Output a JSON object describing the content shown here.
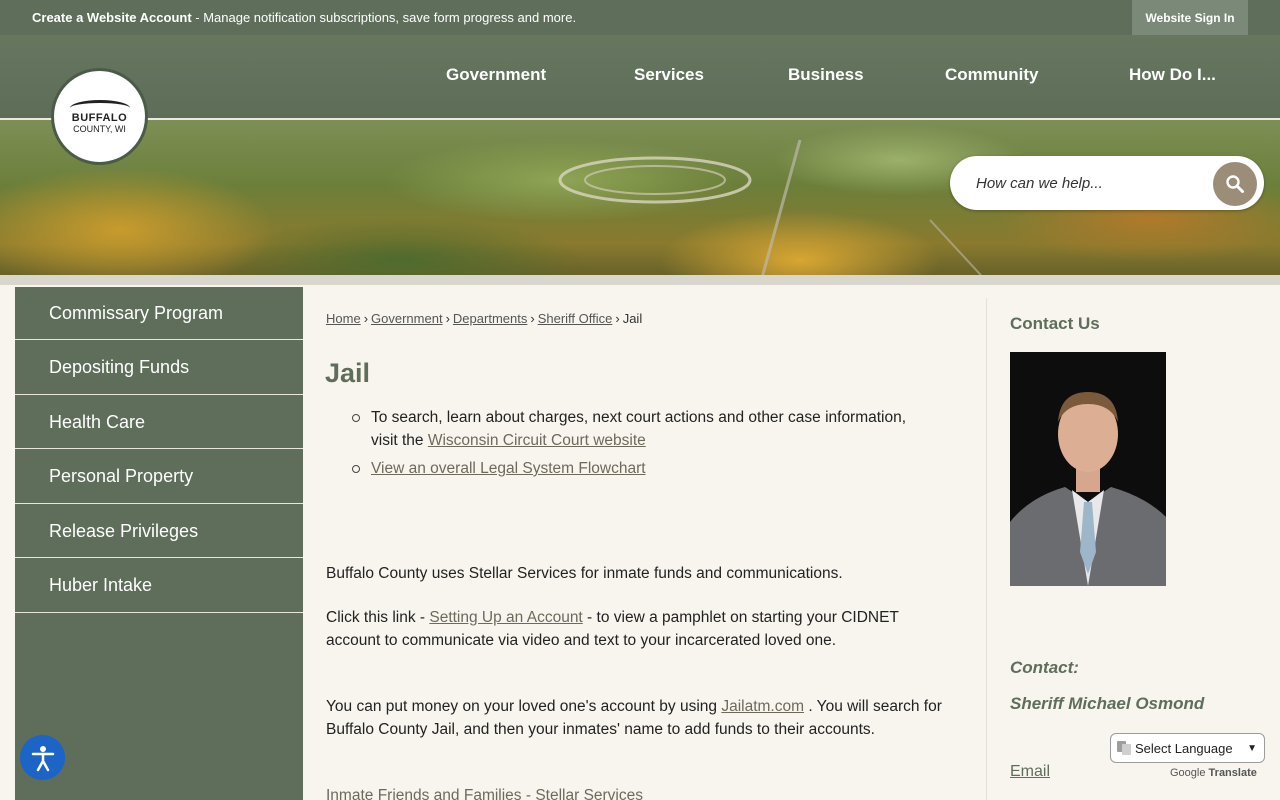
{
  "topbar": {
    "create_label": "Create a Website Account",
    "create_suffix": " - Manage notification subscriptions, save form progress and more.",
    "signin_label": "Website Sign In"
  },
  "logo": {
    "line1": "BUFFALO",
    "line2": "COUNTY, WI"
  },
  "nav": {
    "items": [
      "Government",
      "Services",
      "Business",
      "Community",
      "How Do I..."
    ]
  },
  "search": {
    "placeholder": "How can we help..."
  },
  "sidebar": {
    "items": [
      "Commissary Program",
      "Depositing Funds",
      "Health Care",
      "Personal Property",
      "Release Privileges",
      "Huber Intake"
    ]
  },
  "breadcrumb": {
    "items": [
      "Home",
      "Government",
      "Departments",
      "Sheriff Office"
    ],
    "current": "Jail",
    "separator": "›"
  },
  "page": {
    "title": "Jail",
    "bullet1_text": "To search, learn about charges, next court actions and other case information, visit the ",
    "bullet1_link": "Wisconsin Circuit Court website",
    "bullet2_link": "View an overall Legal System Flowchart",
    "para1": "Buffalo County uses Stellar Services for inmate funds and communications.",
    "para2_pre": "Click this link - ",
    "para2_link": "Setting Up an Account",
    "para2_post": " - to view a pamphlet on starting your CIDNET account to communicate via video and text to your incarcerated loved one.",
    "para3_pre": "You can put money on your loved one's account by using ",
    "para3_link": "Jailatm.com",
    "para3_post": " .  You will search for Buffalo County Jail, and then your inmates' name to add funds to their accounts.",
    "para4_link": "Inmate Friends and Families - Stellar Services"
  },
  "contact": {
    "heading": "Contact Us",
    "label": "Contact:",
    "name": "Sheriff Michael Osmond",
    "email_label": "Email"
  },
  "translate": {
    "select_label": "Select Language",
    "powered_by": "Google",
    "powered_suffix": "Translate"
  },
  "colors": {
    "accent": "#5f6d5b",
    "link": "#6d6a5c",
    "accessibility": "#1c64c6"
  }
}
